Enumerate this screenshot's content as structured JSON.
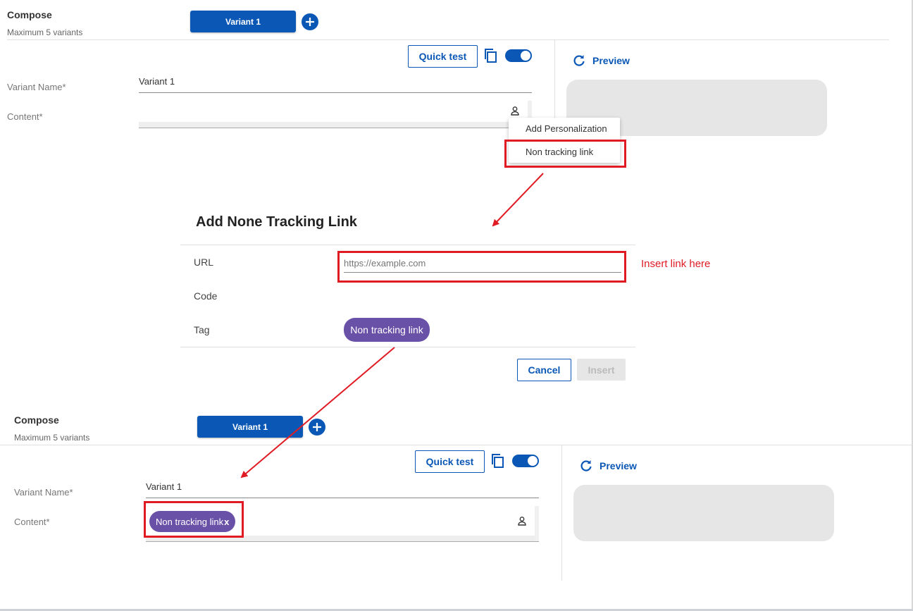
{
  "compose_top": {
    "title": "Compose",
    "subtitle": "Maximum 5 variants",
    "variant_tab": "Variant 1",
    "quick_test": "Quick test",
    "variant_name_label": "Variant Name*",
    "variant_name_value": "Variant 1",
    "content_label": "Content*",
    "preview_label": "Preview"
  },
  "personalization_menu": {
    "items": [
      "Add Personalization",
      "Non tracking link"
    ]
  },
  "dialog": {
    "title": "Add None Tracking Link",
    "url_label": "URL",
    "url_placeholder": "https://example.com",
    "code_label": "Code",
    "tag_label": "Tag",
    "tag_chip": "Non tracking link",
    "cancel": "Cancel",
    "insert": "Insert",
    "annotation": "Insert link here"
  },
  "compose_bottom": {
    "title": "Compose",
    "subtitle": "Maximum 5 variants",
    "variant_tab": "Variant 1",
    "quick_test": "Quick test",
    "variant_name_label": "Variant Name*",
    "variant_name_value": "Variant 1",
    "content_label": "Content*",
    "content_chip": "Non tracking link",
    "chip_remove": "x",
    "preview_label": "Preview"
  },
  "colors": {
    "primary": "#0a57b5",
    "chip": "#6a51a8",
    "annotation": "#e01b24",
    "preview_bg": "#e6e6e6"
  },
  "icons": [
    "plus-icon",
    "copy-icon",
    "toggle-switch",
    "refresh-icon",
    "person-icon",
    "close-icon",
    "arrow-icon"
  ]
}
